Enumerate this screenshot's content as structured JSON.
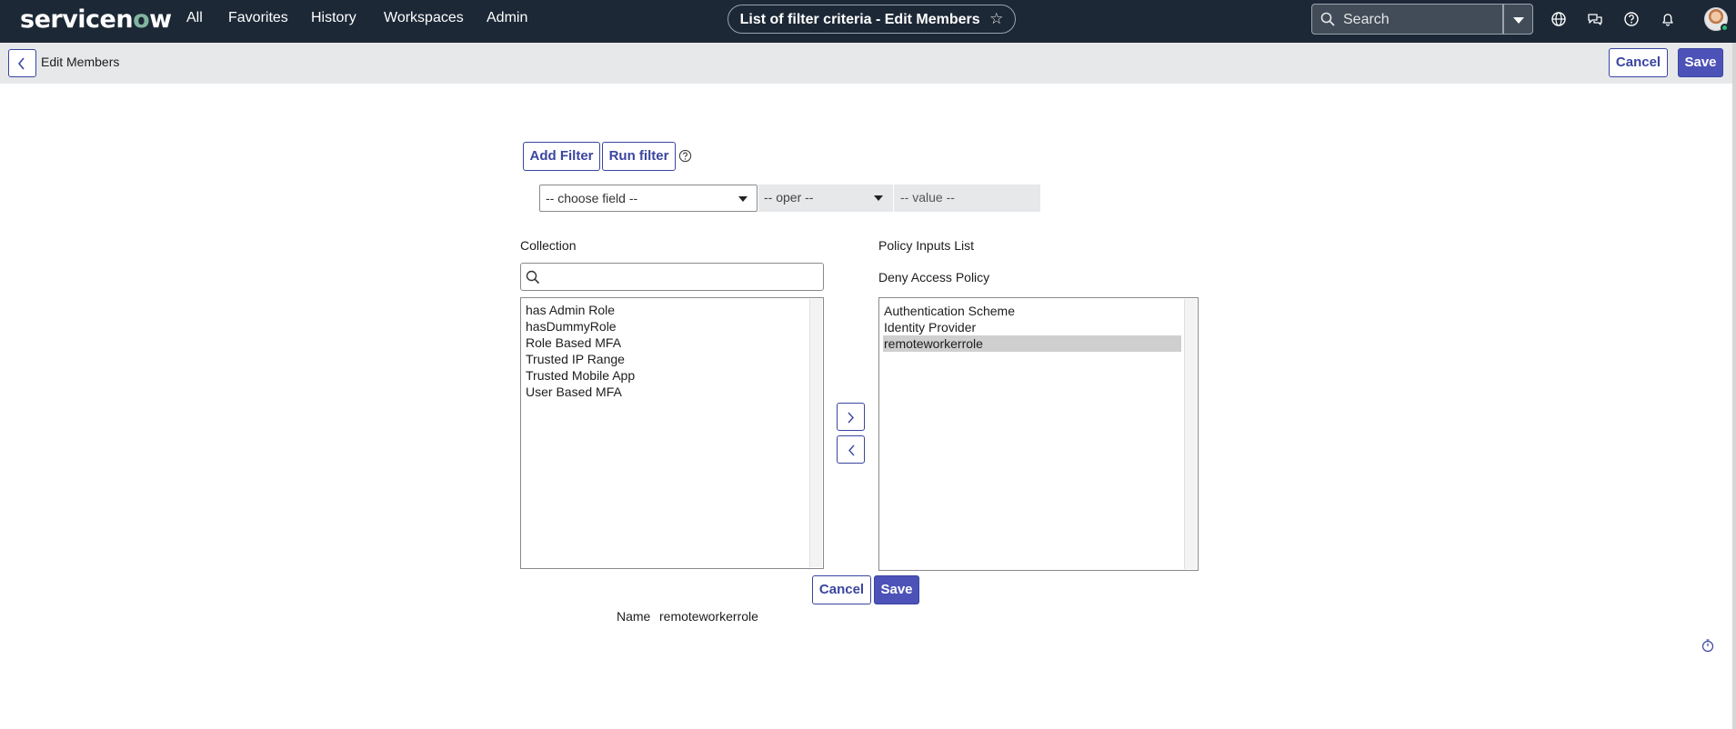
{
  "brand": {
    "pre": "servicen",
    "o": "o",
    "post": "w"
  },
  "nav": {
    "items": [
      "All",
      "Favorites",
      "History",
      "Workspaces",
      "Admin"
    ]
  },
  "page_title": "List of filter criteria - Edit Members",
  "search": {
    "placeholder": "Search"
  },
  "subheader": {
    "title": "Edit Members",
    "cancel_label": "Cancel",
    "save_label": "Save"
  },
  "filter": {
    "add_filter_label": "Add Filter",
    "run_filter_label": "Run filter",
    "field_placeholder": "-- choose field --",
    "oper_placeholder": "-- oper --",
    "value_placeholder": "-- value --"
  },
  "collection": {
    "label": "Collection",
    "items": [
      "has Admin Role",
      "hasDummyRole",
      "Role Based MFA",
      "Trusted IP Range",
      "Trusted Mobile App",
      "User Based MFA"
    ]
  },
  "policy": {
    "list_label": "Policy Inputs List",
    "name_label": "Deny Access Policy",
    "items": [
      "Authentication Scheme",
      "Identity Provider",
      "remoteworkerrole"
    ],
    "selected_index": 2
  },
  "footer": {
    "cancel_label": "Cancel",
    "save_label": "Save",
    "name_label": "Name",
    "name_value": "remoteworkerrole"
  },
  "icons": [
    "search-icon",
    "globe-icon",
    "chat-icon",
    "help-icon",
    "bell-icon",
    "star-icon",
    "back-icon",
    "chevron-right-icon",
    "chevron-left-icon",
    "timer-icon"
  ],
  "colors": {
    "nav_bg": "#1c2836",
    "accent": "#4c52b7",
    "subheader_bg": "#e6e8ea"
  }
}
